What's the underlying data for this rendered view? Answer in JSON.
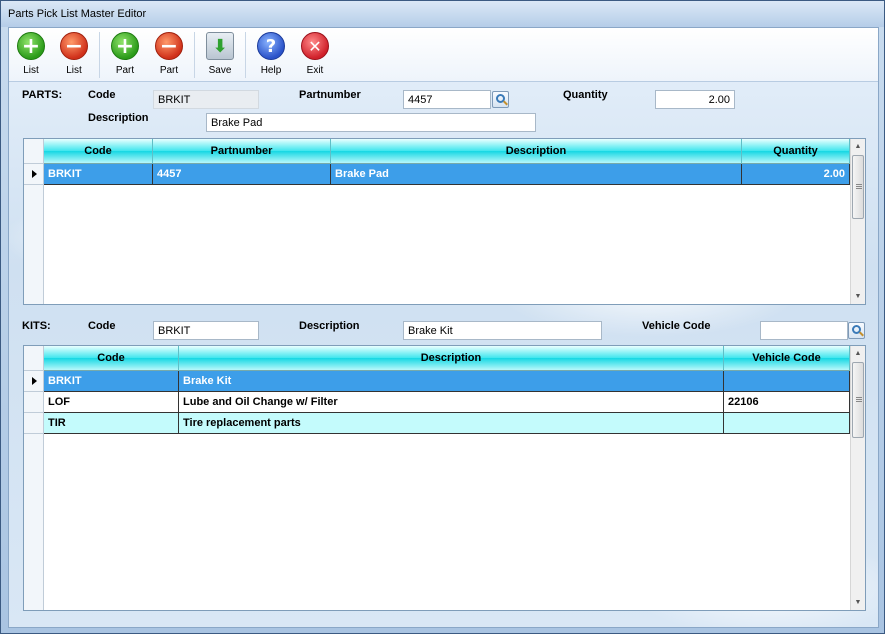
{
  "window": {
    "title": "Parts Pick List Master Editor"
  },
  "toolbar": {
    "buttons": [
      {
        "label": "List",
        "icon": "add-icon"
      },
      {
        "label": "List",
        "icon": "remove-icon"
      },
      {
        "label": "Part",
        "icon": "add-icon"
      },
      {
        "label": "Part",
        "icon": "remove-icon"
      },
      {
        "label": "Save",
        "icon": "save-icon"
      },
      {
        "label": "Help",
        "icon": "help-icon"
      },
      {
        "label": "Exit",
        "icon": "exit-icon"
      }
    ],
    "glyphs": {
      "add": "+",
      "remove": "−",
      "help": "?",
      "exit": "✕",
      "save": "⬇"
    }
  },
  "parts": {
    "section_label": "PARTS:",
    "code_label": "Code",
    "code_value": "BRKIT",
    "partnumber_label": "Partnumber",
    "partnumber_value": "4457",
    "quantity_label": "Quantity",
    "quantity_value": "2.00",
    "description_label": "Description",
    "description_value": "Brake Pad",
    "grid": {
      "columns": [
        "Code",
        "Partnumber",
        "Description",
        "Quantity"
      ],
      "rows": [
        {
          "code": "BRKIT",
          "partnumber": "4457",
          "description": "Brake Pad",
          "quantity": "2.00"
        }
      ]
    }
  },
  "kits": {
    "section_label": "KITS:",
    "code_label": "Code",
    "code_value": "BRKIT",
    "description_label": "Description",
    "description_value": "Brake Kit",
    "vehicle_code_label": "Vehicle Code",
    "vehicle_code_value": "",
    "grid": {
      "columns": [
        "Code",
        "Description",
        "Vehicle Code"
      ],
      "rows": [
        {
          "code": "BRKIT",
          "description": "Brake Kit",
          "vehicle_code": ""
        },
        {
          "code": "LOF",
          "description": "Lube and Oil Change w/ Filter",
          "vehicle_code": "22106"
        },
        {
          "code": "TIR",
          "description": "Tire replacement parts",
          "vehicle_code": ""
        }
      ]
    }
  },
  "colors": {
    "selected_row": "#3d9ee9",
    "alt_row": "#c4fbfc",
    "header_cyan": "#17d8e4"
  }
}
